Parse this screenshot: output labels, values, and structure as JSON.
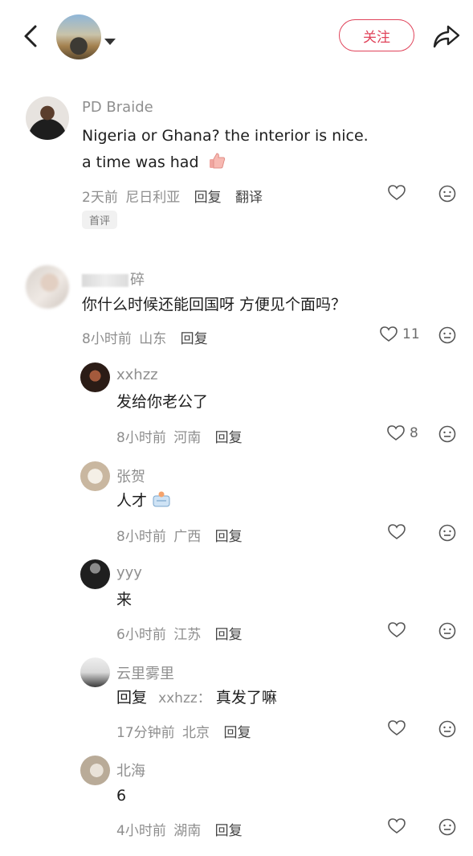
{
  "header": {
    "follow_label": "关注"
  },
  "comments": [
    {
      "name": "PD Braide",
      "text_lines": [
        "Nigeria or Ghana? the interior is nice.",
        "a time was had"
      ],
      "time": "2天前",
      "location": "尼日利亚",
      "reply": "回复",
      "translate": "翻译",
      "badge": "首评",
      "likes": ""
    },
    {
      "name": "碎",
      "text": "你什么时候还能回国呀 方便见个面吗？",
      "time": "8小时前",
      "location": "山东",
      "reply": "回复",
      "likes": "11"
    },
    {
      "name": "xxhzz",
      "text": "发给你老公了",
      "time": "8小时前",
      "location": "河南",
      "reply": "回复",
      "likes": "8"
    },
    {
      "name": "张贺",
      "text": "人才",
      "time": "8小时前",
      "location": "广西",
      "reply": "回复",
      "likes": ""
    },
    {
      "name": "yyy",
      "text": "来",
      "time": "6小时前",
      "location": "江苏",
      "reply": "回复",
      "likes": ""
    },
    {
      "name": "云里雾里",
      "reply_prefix": "回复",
      "reply_target": "xxhzz：",
      "text": "真发了嘛",
      "time": "17分钟前",
      "location": "北京",
      "reply": "回复",
      "likes": ""
    },
    {
      "name": "北海",
      "text": "6",
      "time": "4小时前",
      "location": "湖南",
      "reply": "回复",
      "likes": ""
    }
  ]
}
